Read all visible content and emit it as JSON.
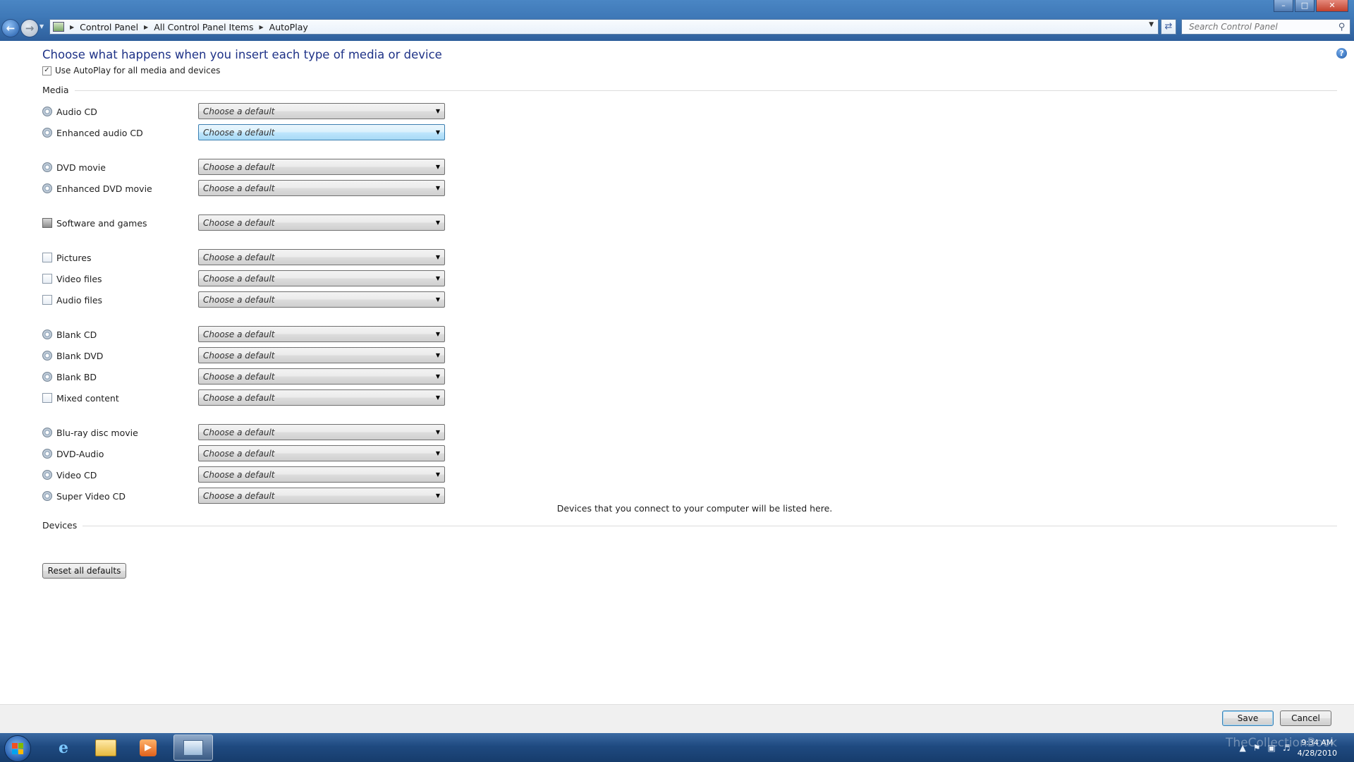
{
  "window": {
    "controls": [
      "minimize",
      "maximize",
      "close"
    ]
  },
  "nav": {
    "back_icon": "back-arrow-icon",
    "forward_icon": "forward-arrow-icon"
  },
  "address": {
    "breadcrumb": [
      "Control Panel",
      "All Control Panel Items",
      "AutoPlay"
    ]
  },
  "search": {
    "placeholder": "Search Control Panel"
  },
  "page": {
    "title": "Choose what happens when you insert each type of media or device",
    "use_autoplay_label": "Use AutoPlay for all media and devices",
    "use_autoplay_checked": true,
    "media_heading": "Media",
    "devices_heading": "Devices",
    "devices_message": "Devices that you connect to your computer will be listed here.",
    "reset_label": "Reset all defaults"
  },
  "media": [
    {
      "label": "Audio CD",
      "value": "Choose a default",
      "icon": "disc-icon"
    },
    {
      "label": "Enhanced audio CD",
      "value": "Choose a default",
      "icon": "disc-icon",
      "focused": true
    },
    {
      "label": "DVD movie",
      "value": "Choose a default",
      "icon": "dvd-icon"
    },
    {
      "label": "Enhanced DVD movie",
      "value": "Choose a default",
      "icon": "dvd-icon"
    },
    {
      "label": "Software and games",
      "value": "Choose a default",
      "icon": "software-icon"
    },
    {
      "label": "Pictures",
      "value": "Choose a default",
      "icon": "picture-file-icon"
    },
    {
      "label": "Video files",
      "value": "Choose a default",
      "icon": "video-file-icon"
    },
    {
      "label": "Audio files",
      "value": "Choose a default",
      "icon": "audio-file-icon"
    },
    {
      "label": "Blank CD",
      "value": "Choose a default",
      "icon": "blank-disc-icon"
    },
    {
      "label": "Blank DVD",
      "value": "Choose a default",
      "icon": "blank-disc-icon"
    },
    {
      "label": "Blank BD",
      "value": "Choose a default",
      "icon": "blank-disc-icon"
    },
    {
      "label": "Mixed content",
      "value": "Choose a default",
      "icon": "mixed-content-icon"
    },
    {
      "label": "Blu-ray disc movie",
      "value": "Choose a default",
      "icon": "bluray-icon"
    },
    {
      "label": "DVD-Audio",
      "value": "Choose a default",
      "icon": "disc-icon"
    },
    {
      "label": "Video CD",
      "value": "Choose a default",
      "icon": "dvd-icon"
    },
    {
      "label": "Super Video CD",
      "value": "Choose a default",
      "icon": "dvd-icon"
    }
  ],
  "footer": {
    "save_label": "Save",
    "cancel_label": "Cancel"
  },
  "taskbar": {
    "time": "9:34 AM",
    "date": "4/28/2010",
    "watermark": "TheCollectionBook"
  },
  "colors": {
    "title_blue": "#1e3287",
    "taskbar": "#1f4a80",
    "titlebar": "#3f79b8"
  }
}
